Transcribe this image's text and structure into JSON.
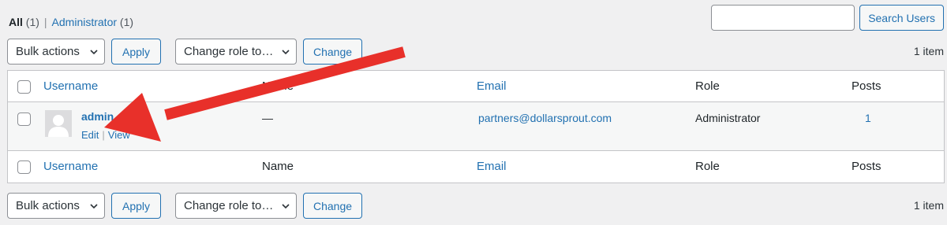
{
  "filters": {
    "all_label": "All",
    "all_count": "(1)",
    "separator": "|",
    "admin_label": "Administrator",
    "admin_count": "(1)"
  },
  "search": {
    "button_label": "Search Users",
    "value": ""
  },
  "tablenav": {
    "bulk_actions": "Bulk actions",
    "apply": "Apply",
    "change_role": "Change role to…",
    "change": "Change",
    "items_count": "1 item"
  },
  "columns": {
    "username": "Username",
    "name": "Name",
    "email": "Email",
    "role": "Role",
    "posts": "Posts"
  },
  "rows": [
    {
      "username": "admin",
      "name": "—",
      "email": "partners@dollarsprout.com",
      "role": "Administrator",
      "posts": "1",
      "actions": {
        "edit": "Edit",
        "sep": "|",
        "view": "View"
      }
    }
  ],
  "colors": {
    "link": "#2271b1",
    "annotation_arrow": "#e8302a",
    "background": "#f0f0f1"
  }
}
